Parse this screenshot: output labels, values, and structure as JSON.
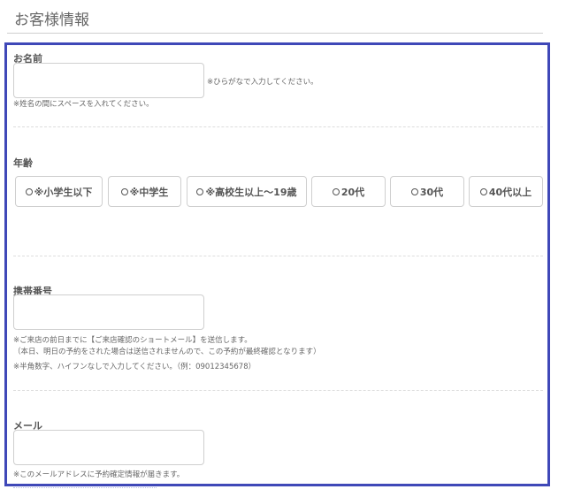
{
  "section": {
    "title": "お客様情報"
  },
  "name": {
    "label": "お名前",
    "value": "",
    "side_hint": "※ひらがなで入力してください。",
    "hint": "※姓名の間にスペースを入れてください。"
  },
  "age": {
    "label": "年齢",
    "options": [
      "※小学生以下",
      "※中学生",
      "※高校生以上〜19歳",
      "20代",
      "30代",
      "40代以上"
    ]
  },
  "phone": {
    "label": "携帯番号",
    "value": "",
    "hint_1": "※ご来店の前日までに【ご来店確認のショートメール】を送信します。",
    "hint_2": "（本日、明日の予約をされた場合は送信されませんので、この予約が最終確認となります）",
    "hint_3": "※半角数字、ハイフンなしで入力してください。（例：09012345678）"
  },
  "email": {
    "label": "メール",
    "value": "",
    "hint": "※このメールアドレスに予約確定情報が届きます。"
  },
  "colors": {
    "frame": "#3f48b8",
    "border": "#cfcfcf",
    "text": "#555555"
  }
}
